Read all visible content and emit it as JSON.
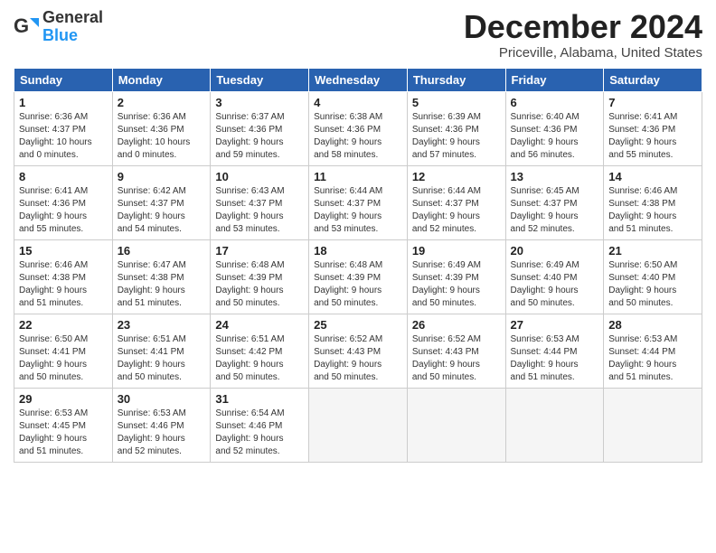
{
  "header": {
    "logo_general": "General",
    "logo_blue": "Blue",
    "title": "December 2024",
    "subtitle": "Priceville, Alabama, United States"
  },
  "weekdays": [
    "Sunday",
    "Monday",
    "Tuesday",
    "Wednesday",
    "Thursday",
    "Friday",
    "Saturday"
  ],
  "weeks": [
    [
      {
        "day": "1",
        "info": "Sunrise: 6:36 AM\nSunset: 4:37 PM\nDaylight: 10 hours\nand 0 minutes."
      },
      {
        "day": "2",
        "info": "Sunrise: 6:36 AM\nSunset: 4:36 PM\nDaylight: 10 hours\nand 0 minutes."
      },
      {
        "day": "3",
        "info": "Sunrise: 6:37 AM\nSunset: 4:36 PM\nDaylight: 9 hours\nand 59 minutes."
      },
      {
        "day": "4",
        "info": "Sunrise: 6:38 AM\nSunset: 4:36 PM\nDaylight: 9 hours\nand 58 minutes."
      },
      {
        "day": "5",
        "info": "Sunrise: 6:39 AM\nSunset: 4:36 PM\nDaylight: 9 hours\nand 57 minutes."
      },
      {
        "day": "6",
        "info": "Sunrise: 6:40 AM\nSunset: 4:36 PM\nDaylight: 9 hours\nand 56 minutes."
      },
      {
        "day": "7",
        "info": "Sunrise: 6:41 AM\nSunset: 4:36 PM\nDaylight: 9 hours\nand 55 minutes."
      }
    ],
    [
      {
        "day": "8",
        "info": "Sunrise: 6:41 AM\nSunset: 4:36 PM\nDaylight: 9 hours\nand 55 minutes."
      },
      {
        "day": "9",
        "info": "Sunrise: 6:42 AM\nSunset: 4:37 PM\nDaylight: 9 hours\nand 54 minutes."
      },
      {
        "day": "10",
        "info": "Sunrise: 6:43 AM\nSunset: 4:37 PM\nDaylight: 9 hours\nand 53 minutes."
      },
      {
        "day": "11",
        "info": "Sunrise: 6:44 AM\nSunset: 4:37 PM\nDaylight: 9 hours\nand 53 minutes."
      },
      {
        "day": "12",
        "info": "Sunrise: 6:44 AM\nSunset: 4:37 PM\nDaylight: 9 hours\nand 52 minutes."
      },
      {
        "day": "13",
        "info": "Sunrise: 6:45 AM\nSunset: 4:37 PM\nDaylight: 9 hours\nand 52 minutes."
      },
      {
        "day": "14",
        "info": "Sunrise: 6:46 AM\nSunset: 4:38 PM\nDaylight: 9 hours\nand 51 minutes."
      }
    ],
    [
      {
        "day": "15",
        "info": "Sunrise: 6:46 AM\nSunset: 4:38 PM\nDaylight: 9 hours\nand 51 minutes."
      },
      {
        "day": "16",
        "info": "Sunrise: 6:47 AM\nSunset: 4:38 PM\nDaylight: 9 hours\nand 51 minutes."
      },
      {
        "day": "17",
        "info": "Sunrise: 6:48 AM\nSunset: 4:39 PM\nDaylight: 9 hours\nand 50 minutes."
      },
      {
        "day": "18",
        "info": "Sunrise: 6:48 AM\nSunset: 4:39 PM\nDaylight: 9 hours\nand 50 minutes."
      },
      {
        "day": "19",
        "info": "Sunrise: 6:49 AM\nSunset: 4:39 PM\nDaylight: 9 hours\nand 50 minutes."
      },
      {
        "day": "20",
        "info": "Sunrise: 6:49 AM\nSunset: 4:40 PM\nDaylight: 9 hours\nand 50 minutes."
      },
      {
        "day": "21",
        "info": "Sunrise: 6:50 AM\nSunset: 4:40 PM\nDaylight: 9 hours\nand 50 minutes."
      }
    ],
    [
      {
        "day": "22",
        "info": "Sunrise: 6:50 AM\nSunset: 4:41 PM\nDaylight: 9 hours\nand 50 minutes."
      },
      {
        "day": "23",
        "info": "Sunrise: 6:51 AM\nSunset: 4:41 PM\nDaylight: 9 hours\nand 50 minutes."
      },
      {
        "day": "24",
        "info": "Sunrise: 6:51 AM\nSunset: 4:42 PM\nDaylight: 9 hours\nand 50 minutes."
      },
      {
        "day": "25",
        "info": "Sunrise: 6:52 AM\nSunset: 4:43 PM\nDaylight: 9 hours\nand 50 minutes."
      },
      {
        "day": "26",
        "info": "Sunrise: 6:52 AM\nSunset: 4:43 PM\nDaylight: 9 hours\nand 50 minutes."
      },
      {
        "day": "27",
        "info": "Sunrise: 6:53 AM\nSunset: 4:44 PM\nDaylight: 9 hours\nand 51 minutes."
      },
      {
        "day": "28",
        "info": "Sunrise: 6:53 AM\nSunset: 4:44 PM\nDaylight: 9 hours\nand 51 minutes."
      }
    ],
    [
      {
        "day": "29",
        "info": "Sunrise: 6:53 AM\nSunset: 4:45 PM\nDaylight: 9 hours\nand 51 minutes."
      },
      {
        "day": "30",
        "info": "Sunrise: 6:53 AM\nSunset: 4:46 PM\nDaylight: 9 hours\nand 52 minutes."
      },
      {
        "day": "31",
        "info": "Sunrise: 6:54 AM\nSunset: 4:46 PM\nDaylight: 9 hours\nand 52 minutes."
      },
      null,
      null,
      null,
      null
    ]
  ]
}
